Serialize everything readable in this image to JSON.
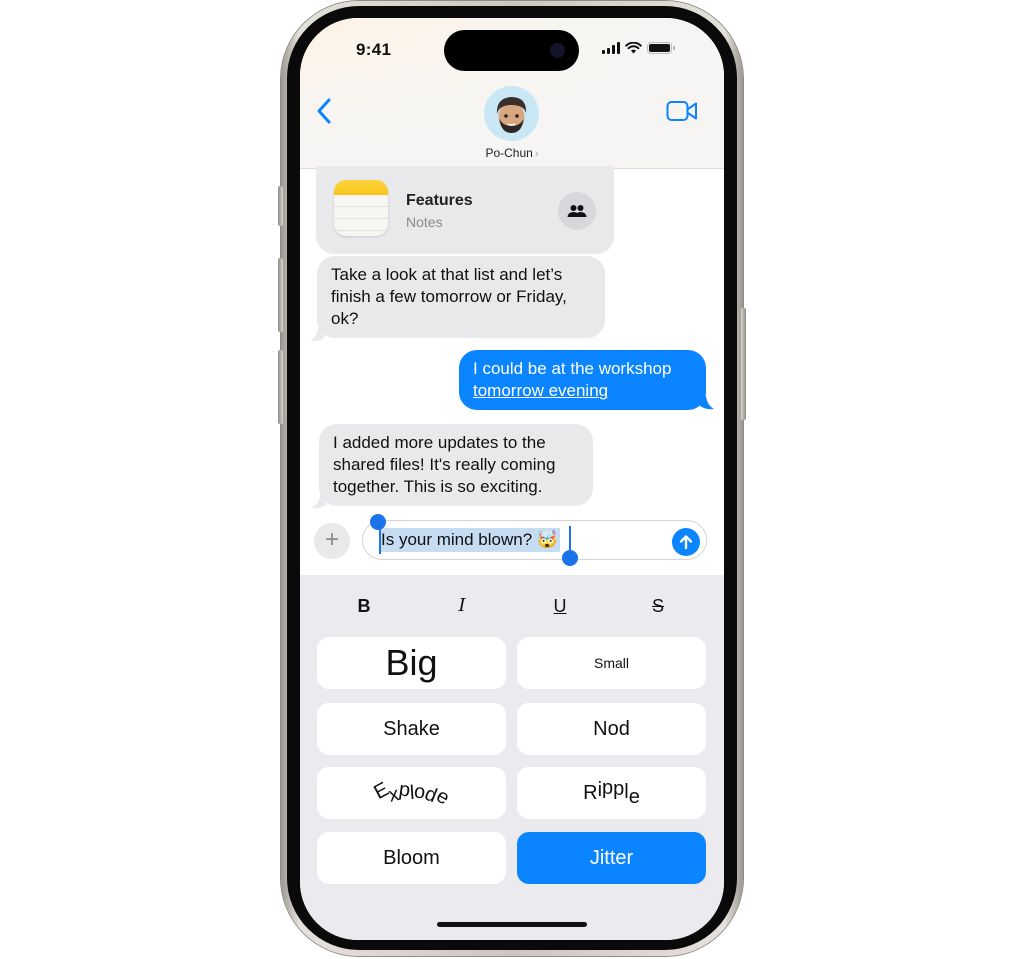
{
  "status_bar": {
    "time": "9:41",
    "icons": [
      "cellular-signal-icon",
      "wifi-icon",
      "battery-icon"
    ]
  },
  "header": {
    "back_icon": "chevron-left-icon",
    "contact_name": "Po-Chun",
    "contact_chevron": "›",
    "avatar": "memoji-avatar",
    "video_icon": "video-camera-icon"
  },
  "messages": [
    {
      "type": "shared-note",
      "direction": "incoming",
      "title": "Features",
      "subtitle": "Notes",
      "icon": "notes-app-icon",
      "action_icon": "people-icon"
    },
    {
      "type": "text",
      "direction": "incoming",
      "lines": [
        "Take a look at that list and let’s",
        "finish a few tomorrow or Friday,",
        "ok?"
      ]
    },
    {
      "type": "text",
      "direction": "outgoing",
      "lines": [
        "I could be at the workshop",
        "tomorrow evening"
      ],
      "link_text": "tomorrow evening"
    },
    {
      "type": "text",
      "direction": "incoming",
      "lines": [
        "I added more updates to the",
        "shared files! It's really coming",
        "together. This is so exciting."
      ]
    }
  ],
  "composer": {
    "plus_label": "+",
    "text": "Is your mind blown? 🤯",
    "selected_text": "Is your mind blown? 🤯",
    "send_icon": "arrow-up-icon"
  },
  "formatting": {
    "bold": "B",
    "italic": "I",
    "underline": "U",
    "strikethrough": "S"
  },
  "effects": [
    {
      "label": "Big",
      "selected": false
    },
    {
      "label": "Small",
      "selected": false
    },
    {
      "label": "Shake",
      "selected": false
    },
    {
      "label": "Nod",
      "selected": false
    },
    {
      "label": "Explode",
      "selected": false
    },
    {
      "label": "Ripple",
      "selected": false
    },
    {
      "label": "Bloom",
      "selected": false
    },
    {
      "label": "Jitter",
      "selected": true
    }
  ],
  "colors": {
    "accent": "#0a84ff",
    "incoming_bubble": "#e9e9eb",
    "panel_bg": "#ebebef",
    "selection_highlight": "#c6dcf3"
  }
}
